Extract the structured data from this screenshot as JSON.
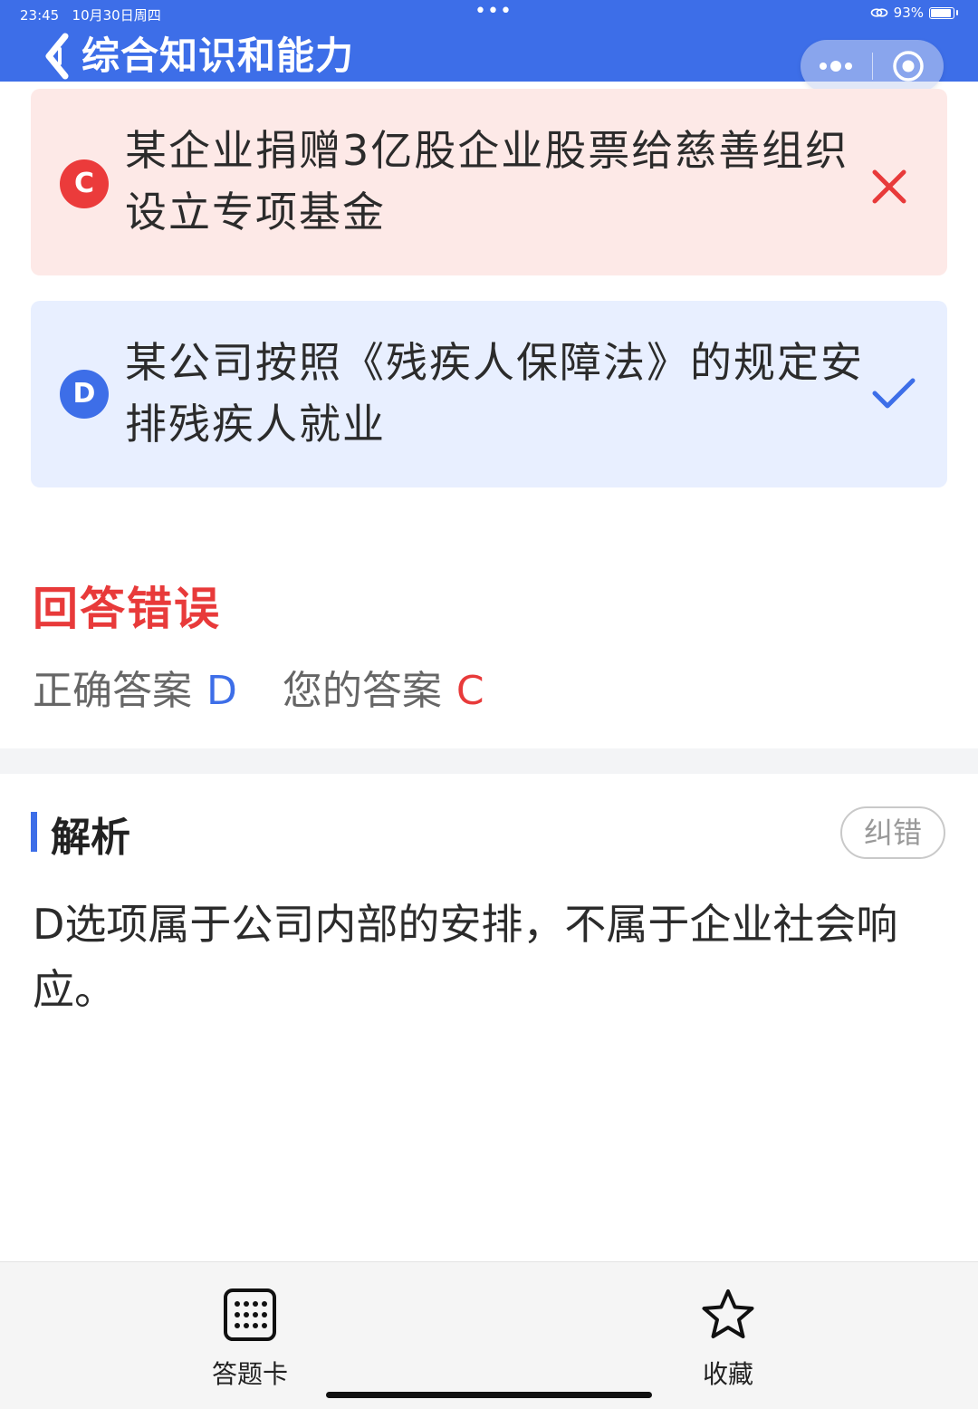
{
  "status": {
    "time": "23:45",
    "date": "10月30日周四",
    "dots": "•••",
    "battery": "93%",
    "battery_level": 0.93
  },
  "header": {
    "title": "综合知识和能力",
    "back_icon": "chevron-left-icon",
    "more_icon": "more-dots-icon",
    "close_icon": "target-circle-icon"
  },
  "options": [
    {
      "letter": "C",
      "text": "某企业捐赠3亿股企业股票给慈善组织设立专项基金",
      "state": "wrong",
      "mark_icon": "cross-icon"
    },
    {
      "letter": "D",
      "text": "某公司按照《残疾人保障法》的规定安排残疾人就业",
      "state": "correct",
      "mark_icon": "check-icon"
    }
  ],
  "result": {
    "title": "回答错误",
    "correct_label": "正确答案",
    "correct_value": "D",
    "user_label": "您的答案",
    "user_value": "C"
  },
  "analysis": {
    "title": "解析",
    "report_label": "纠错",
    "text": "D选项属于公司内部的安排，不属于企业社会响应。"
  },
  "bottom": {
    "card_label": "答题卡",
    "card_icon": "grid-icon",
    "fav_label": "收藏",
    "fav_icon": "star-icon"
  },
  "colors": {
    "primary": "#3d6ee8",
    "error": "#e83a3a",
    "wrong_bg": "#fde9e7",
    "correct_bg": "#e8efff"
  }
}
